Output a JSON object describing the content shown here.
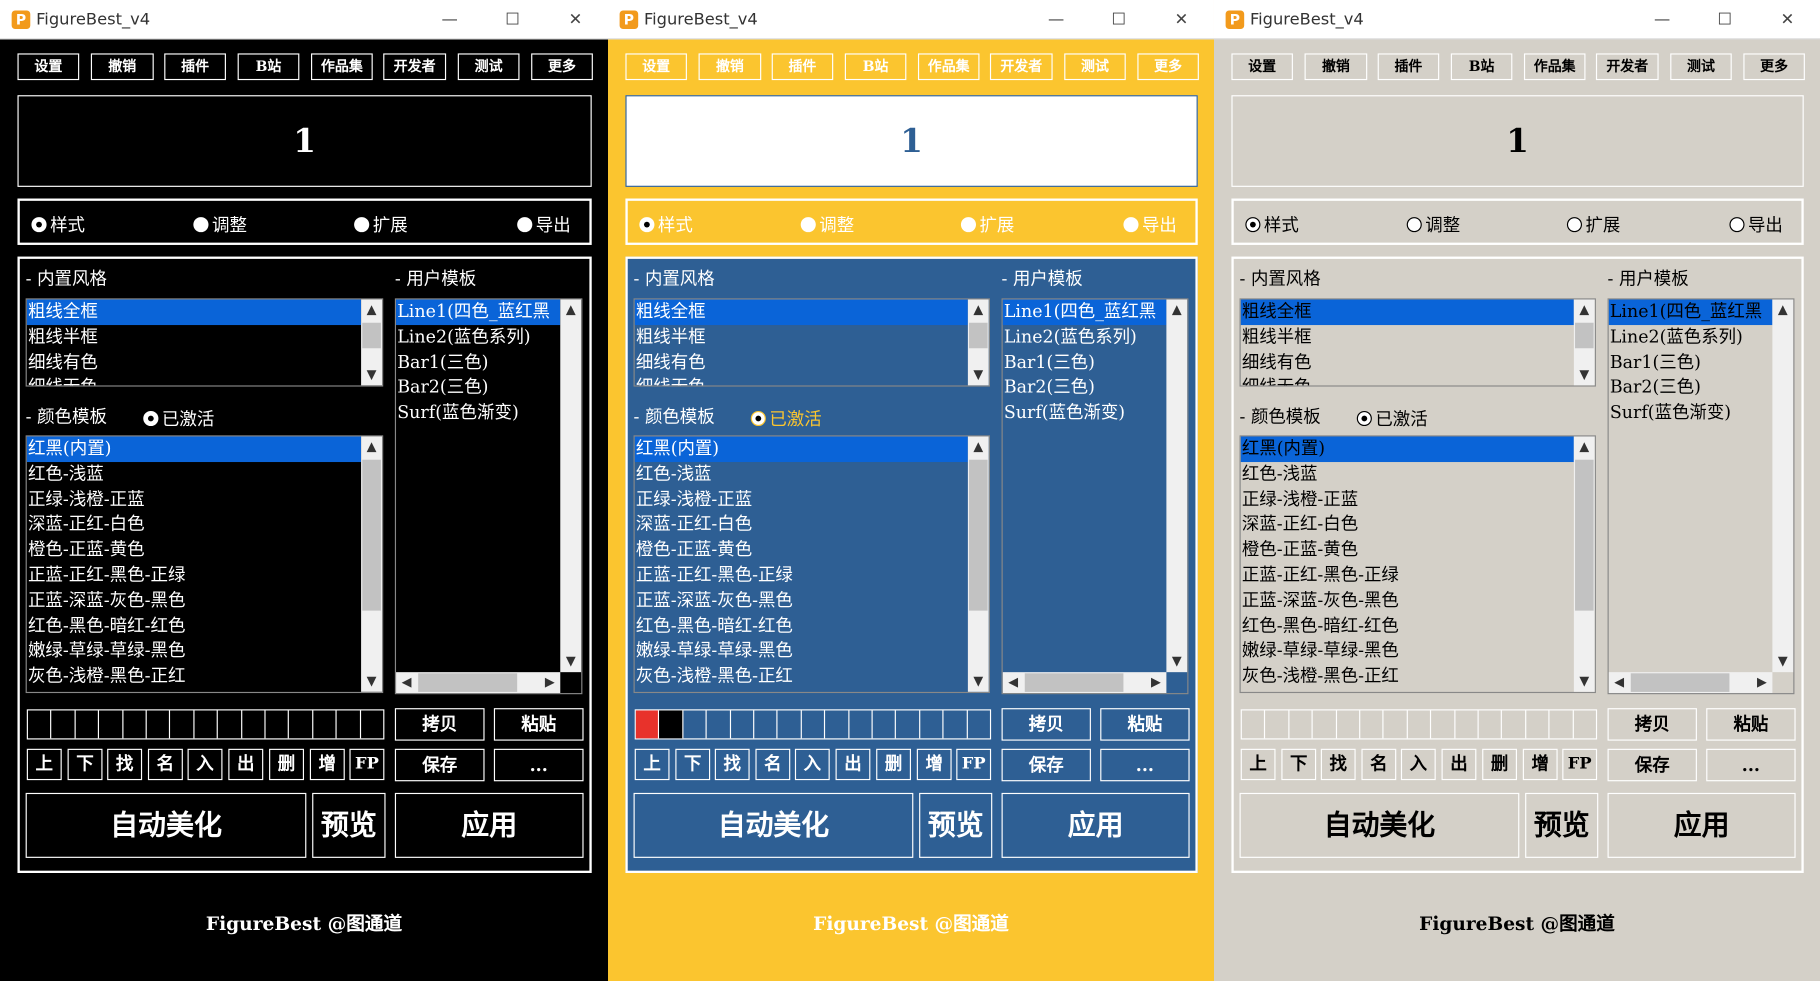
{
  "window": {
    "title": "FigureBest_v4",
    "icon_letter": "P",
    "min_glyph": "—",
    "max_glyph": "☐",
    "close_glyph": "✕"
  },
  "toolbar": [
    "设置",
    "撤销",
    "插件",
    "B站",
    "作品集",
    "开发者",
    "测试",
    "更多"
  ],
  "display_value": "1",
  "tabs": [
    {
      "label": "样式",
      "selected": true
    },
    {
      "label": "调整",
      "selected": false
    },
    {
      "label": "扩展",
      "selected": false
    },
    {
      "label": "导出",
      "selected": false
    }
  ],
  "builtin_styles": {
    "label": "- 内置风格",
    "items": [
      "粗线全框",
      "粗线半框",
      "细线有色",
      "细线无色"
    ],
    "selected_index": 0
  },
  "user_templates": {
    "label": "- 用户模板",
    "items": [
      "Line1(四色_蓝红黑",
      "Line2(蓝色系列)",
      "Bar1(三色)",
      "Bar2(三色)",
      "Surf(蓝色渐变)"
    ],
    "selected_index": 0
  },
  "color_templates": {
    "label": "- 颜色模板",
    "activated_label": "已激活",
    "items": [
      "红黑(内置)",
      "红色-浅蓝",
      "正绿-浅橙-正蓝",
      "深蓝-正红-白色",
      "橙色-正蓝-黄色",
      "正蓝-正红-黑色-正绿",
      "正蓝-深蓝-灰色-黑色",
      "红色-黑色-暗红-红色",
      "嫩绿-草绿-草绿-黑色",
      "灰色-浅橙-黑色-正红"
    ],
    "selected_index": 0
  },
  "swatch_count": 15,
  "small_buttons": [
    "上",
    "下",
    "找",
    "名",
    "入",
    "出",
    "删",
    "增",
    "FP"
  ],
  "action_buttons": {
    "copy": "拷贝",
    "paste": "粘贴",
    "save": "保存",
    "more": "..."
  },
  "big_buttons": {
    "auto": "自动美化",
    "preview": "预览",
    "apply": "应用"
  },
  "footer": "FigureBest @图通道",
  "themes": [
    {
      "name": "black",
      "swatches": []
    },
    {
      "name": "yellow-blue",
      "swatches": [
        "#e8322b",
        "#000000"
      ]
    },
    {
      "name": "gray",
      "swatches": []
    }
  ],
  "colors": {
    "accent_blue": "#2e5f94",
    "accent_yellow": "#fbc52f",
    "gray_bg": "#d4d0c8",
    "selection": "#0a64d8"
  }
}
